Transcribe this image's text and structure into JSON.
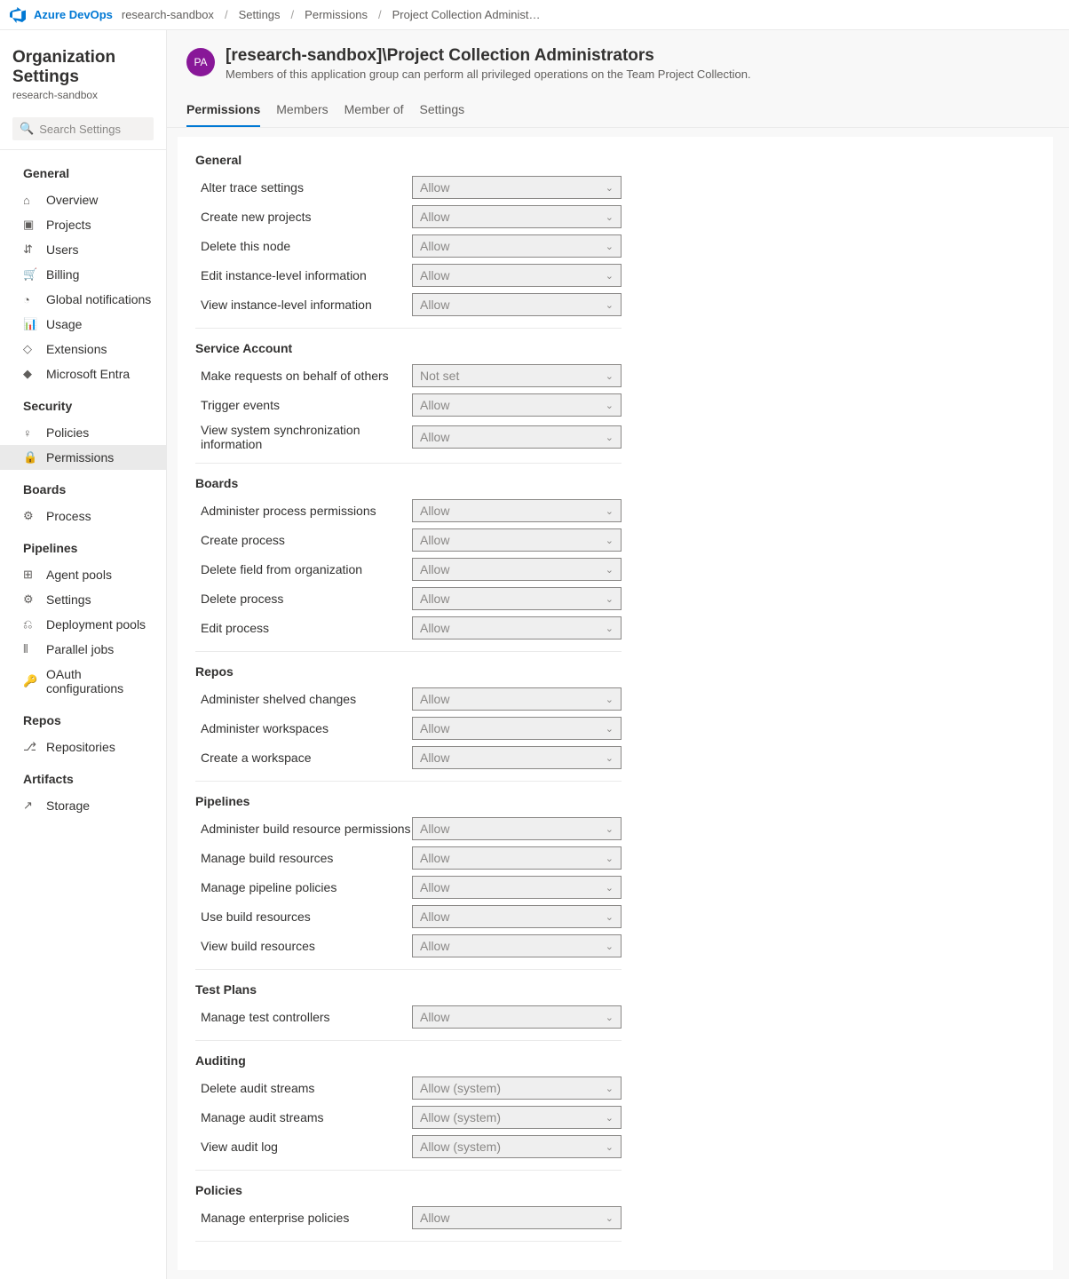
{
  "topbar": {
    "brand": "Azure DevOps",
    "crumbs": [
      "research-sandbox",
      "Settings",
      "Permissions",
      "Project Collection Administ…"
    ]
  },
  "sidebar": {
    "title": "Organization Settings",
    "subtitle": "research-sandbox",
    "search_placeholder": "Search Settings",
    "sections": [
      {
        "title": "General",
        "items": [
          {
            "label": "Overview",
            "icon": "⌂"
          },
          {
            "label": "Projects",
            "icon": "▣"
          },
          {
            "label": "Users",
            "icon": "⇵"
          },
          {
            "label": "Billing",
            "icon": "🛒"
          },
          {
            "label": "Global notifications",
            "icon": "◔"
          },
          {
            "label": "Usage",
            "icon": "📊"
          },
          {
            "label": "Extensions",
            "icon": "◇"
          },
          {
            "label": "Microsoft Entra",
            "icon": "◆"
          }
        ]
      },
      {
        "title": "Security",
        "items": [
          {
            "label": "Policies",
            "icon": "♀"
          },
          {
            "label": "Permissions",
            "icon": "🔒",
            "active": true
          }
        ]
      },
      {
        "title": "Boards",
        "items": [
          {
            "label": "Process",
            "icon": "⚙"
          }
        ]
      },
      {
        "title": "Pipelines",
        "items": [
          {
            "label": "Agent pools",
            "icon": "⊞"
          },
          {
            "label": "Settings",
            "icon": "⚙"
          },
          {
            "label": "Deployment pools",
            "icon": "⎌"
          },
          {
            "label": "Parallel jobs",
            "icon": "⦀"
          },
          {
            "label": "OAuth configurations",
            "icon": "🔑"
          }
        ]
      },
      {
        "title": "Repos",
        "items": [
          {
            "label": "Repositories",
            "icon": "⎇"
          }
        ]
      },
      {
        "title": "Artifacts",
        "items": [
          {
            "label": "Storage",
            "icon": "↗"
          }
        ]
      }
    ]
  },
  "header": {
    "avatar_initials": "PA",
    "title": "[research-sandbox]\\Project Collection Administrators",
    "description": "Members of this application group can perform all privileged operations on the Team Project Collection.",
    "tabs": [
      "Permissions",
      "Members",
      "Member of",
      "Settings"
    ],
    "active_tab": 0
  },
  "permissions": [
    {
      "title": "General",
      "rows": [
        {
          "label": "Alter trace settings",
          "value": "Allow"
        },
        {
          "label": "Create new projects",
          "value": "Allow"
        },
        {
          "label": "Delete this node",
          "value": "Allow"
        },
        {
          "label": "Edit instance-level information",
          "value": "Allow"
        },
        {
          "label": "View instance-level information",
          "value": "Allow"
        }
      ]
    },
    {
      "title": "Service Account",
      "rows": [
        {
          "label": "Make requests on behalf of others",
          "value": "Not set"
        },
        {
          "label": "Trigger events",
          "value": "Allow"
        },
        {
          "label": "View system synchronization information",
          "value": "Allow"
        }
      ]
    },
    {
      "title": "Boards",
      "rows": [
        {
          "label": "Administer process permissions",
          "value": "Allow"
        },
        {
          "label": "Create process",
          "value": "Allow"
        },
        {
          "label": "Delete field from organization",
          "value": "Allow"
        },
        {
          "label": "Delete process",
          "value": "Allow"
        },
        {
          "label": "Edit process",
          "value": "Allow"
        }
      ]
    },
    {
      "title": "Repos",
      "rows": [
        {
          "label": "Administer shelved changes",
          "value": "Allow"
        },
        {
          "label": "Administer workspaces",
          "value": "Allow"
        },
        {
          "label": "Create a workspace",
          "value": "Allow"
        }
      ]
    },
    {
      "title": "Pipelines",
      "rows": [
        {
          "label": "Administer build resource permissions",
          "value": "Allow"
        },
        {
          "label": "Manage build resources",
          "value": "Allow"
        },
        {
          "label": "Manage pipeline policies",
          "value": "Allow"
        },
        {
          "label": "Use build resources",
          "value": "Allow"
        },
        {
          "label": "View build resources",
          "value": "Allow"
        }
      ]
    },
    {
      "title": "Test Plans",
      "rows": [
        {
          "label": "Manage test controllers",
          "value": "Allow"
        }
      ]
    },
    {
      "title": "Auditing",
      "rows": [
        {
          "label": "Delete audit streams",
          "value": "Allow (system)"
        },
        {
          "label": "Manage audit streams",
          "value": "Allow (system)"
        },
        {
          "label": "View audit log",
          "value": "Allow (system)"
        }
      ]
    },
    {
      "title": "Policies",
      "rows": [
        {
          "label": "Manage enterprise policies",
          "value": "Allow"
        }
      ]
    }
  ]
}
